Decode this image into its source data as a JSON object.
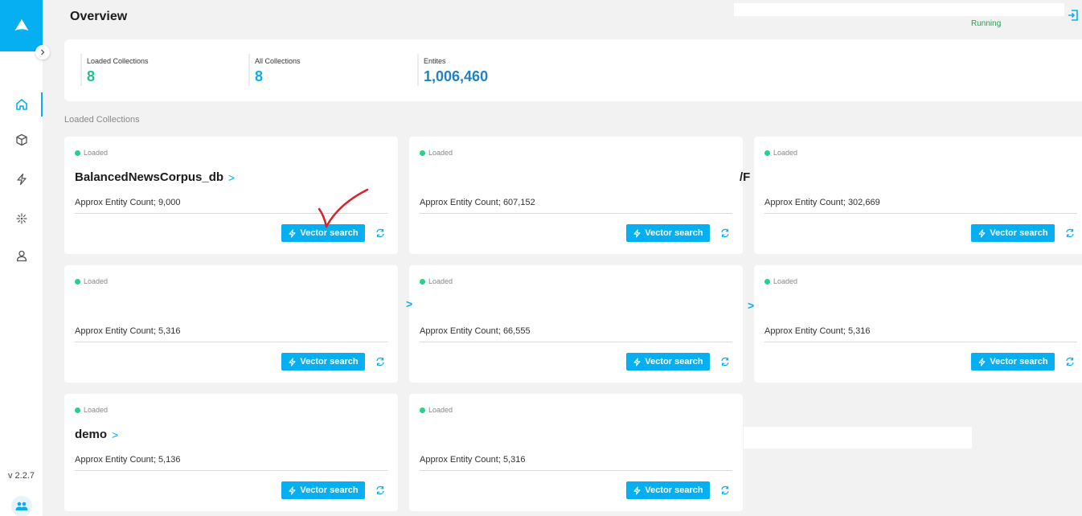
{
  "app": {
    "title": "Overview",
    "version": "v 2.2.7",
    "status": "Running"
  },
  "sidebar": {
    "items": [
      {
        "icon": "home-icon",
        "active": true
      },
      {
        "icon": "cube-icon",
        "active": false
      },
      {
        "icon": "lightning-icon",
        "active": false
      },
      {
        "icon": "sparkle-icon",
        "active": false
      },
      {
        "icon": "user-icon",
        "active": false
      }
    ]
  },
  "overview": {
    "stats": [
      {
        "label": "Loaded Collections",
        "value": "8",
        "color": "#1fbf8f"
      },
      {
        "label": "All Collections",
        "value": "8",
        "color": "#06aff2"
      },
      {
        "label": "Entites",
        "value": "1,006,460",
        "color": "#2182c4"
      }
    ]
  },
  "section_label": "Loaded Collections",
  "cards": [
    {
      "status": "Loaded",
      "name": "BalancedNewsCorpus_db",
      "count": "Approx Entity Count;  9,000",
      "button": "Vector search"
    },
    {
      "status": "Loaded",
      "name": "",
      "count": "Approx Entity Count;  607,152",
      "button": "Vector search"
    },
    {
      "status": "Loaded",
      "name": "",
      "count": "Approx Entity Count;  302,669",
      "button": "Vector search"
    },
    {
      "status": "Loaded",
      "name": "",
      "count": "Approx Entity Count;  5,316",
      "button": "Vector search"
    },
    {
      "status": "Loaded",
      "name": "",
      "count": "Approx Entity Count;  66,555",
      "button": "Vector search"
    },
    {
      "status": "Loaded",
      "name": "",
      "count": "Approx Entity Count;  5,316",
      "button": "Vector search"
    },
    {
      "status": "Loaded",
      "name": "demo",
      "count": "Approx Entity Count;  5,136",
      "button": "Vector search"
    },
    {
      "status": "Loaded",
      "name": "",
      "count": "Approx Entity Count;  5,316",
      "button": "Vector search"
    }
  ],
  "fragments": {
    "slash_text": "/F",
    "chevron": ">"
  },
  "colors": {
    "accent": "#06aff2",
    "loaded_dot": "#22d48b",
    "running": "#1aa34a",
    "annotation": "#d8232a"
  }
}
